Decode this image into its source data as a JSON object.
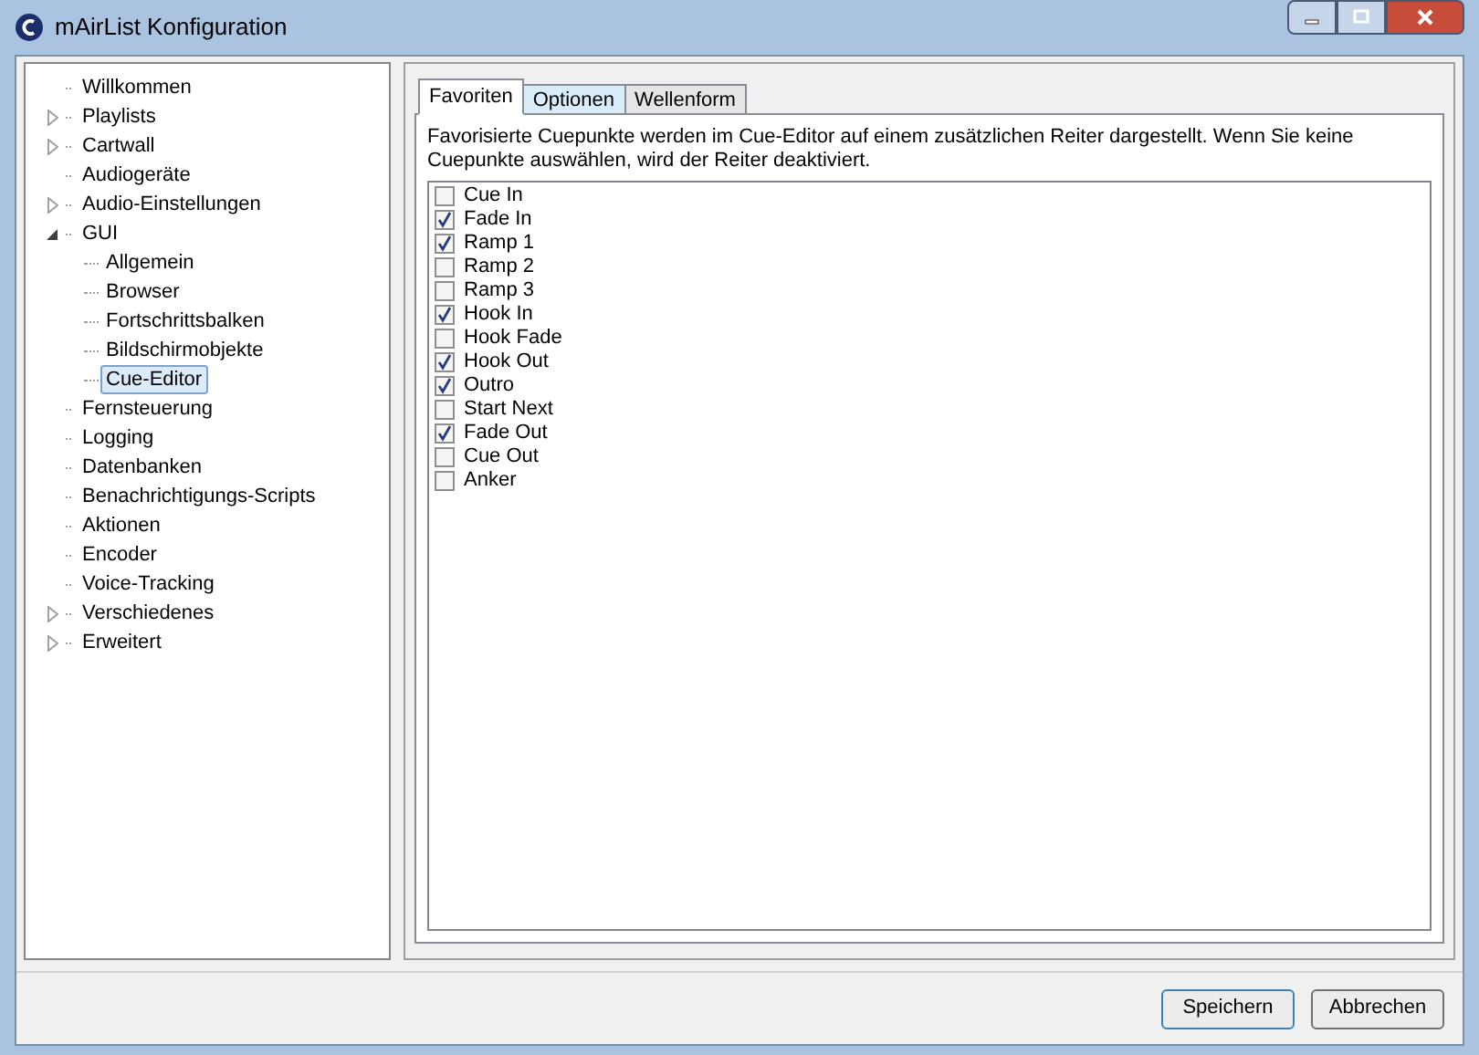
{
  "window": {
    "title": "mAirList Konfiguration"
  },
  "sidebar": {
    "items": [
      {
        "label": "Willkommen",
        "kind": "leaf",
        "selected": false
      },
      {
        "label": "Playlists",
        "kind": "branch",
        "expanded": false,
        "selected": false
      },
      {
        "label": "Cartwall",
        "kind": "branch",
        "expanded": false,
        "selected": false
      },
      {
        "label": "Audiogeräte",
        "kind": "leaf",
        "selected": false
      },
      {
        "label": "Audio-Einstellungen",
        "kind": "branch",
        "expanded": false,
        "selected": false
      },
      {
        "label": "GUI",
        "kind": "branch",
        "expanded": true,
        "selected": false,
        "children": [
          {
            "label": "Allgemein",
            "selected": false
          },
          {
            "label": "Browser",
            "selected": false
          },
          {
            "label": "Fortschrittsbalken",
            "selected": false
          },
          {
            "label": "Bildschirmobjekte",
            "selected": false
          },
          {
            "label": "Cue-Editor",
            "selected": true
          }
        ]
      },
      {
        "label": "Fernsteuerung",
        "kind": "leaf",
        "selected": false
      },
      {
        "label": "Logging",
        "kind": "leaf",
        "selected": false
      },
      {
        "label": "Datenbanken",
        "kind": "leaf",
        "selected": false
      },
      {
        "label": "Benachrichtigungs-Scripts",
        "kind": "leaf",
        "selected": false
      },
      {
        "label": "Aktionen",
        "kind": "leaf",
        "selected": false
      },
      {
        "label": "Encoder",
        "kind": "leaf",
        "selected": false
      },
      {
        "label": "Voice-Tracking",
        "kind": "leaf",
        "selected": false
      },
      {
        "label": "Verschiedenes",
        "kind": "branch",
        "expanded": false,
        "selected": false
      },
      {
        "label": "Erweitert",
        "kind": "branch",
        "expanded": false,
        "selected": false
      }
    ]
  },
  "tabs": [
    {
      "label": "Favoriten",
      "selected": true
    },
    {
      "label": "Optionen",
      "selected": false
    },
    {
      "label": "Wellenform",
      "selected": false
    }
  ],
  "description": "Favorisierte Cuepunkte werden im Cue-Editor auf einem zusätzlichen Reiter dargestellt. Wenn Sie keine Cuepunkte auswählen, wird der Reiter deaktiviert.",
  "cue_points": [
    {
      "label": "Cue In",
      "checked": false
    },
    {
      "label": "Fade In",
      "checked": true
    },
    {
      "label": "Ramp 1",
      "checked": true
    },
    {
      "label": "Ramp 2",
      "checked": false
    },
    {
      "label": "Ramp 3",
      "checked": false
    },
    {
      "label": "Hook In",
      "checked": true
    },
    {
      "label": "Hook Fade",
      "checked": false
    },
    {
      "label": "Hook Out",
      "checked": true
    },
    {
      "label": "Outro",
      "checked": true
    },
    {
      "label": "Start Next",
      "checked": false
    },
    {
      "label": "Fade Out",
      "checked": true
    },
    {
      "label": "Cue Out",
      "checked": false
    },
    {
      "label": "Anker",
      "checked": false
    }
  ],
  "buttons": [
    {
      "label": "Speichern",
      "kind": "default"
    },
    {
      "label": "Abbrechen",
      "kind": "normal"
    }
  ]
}
